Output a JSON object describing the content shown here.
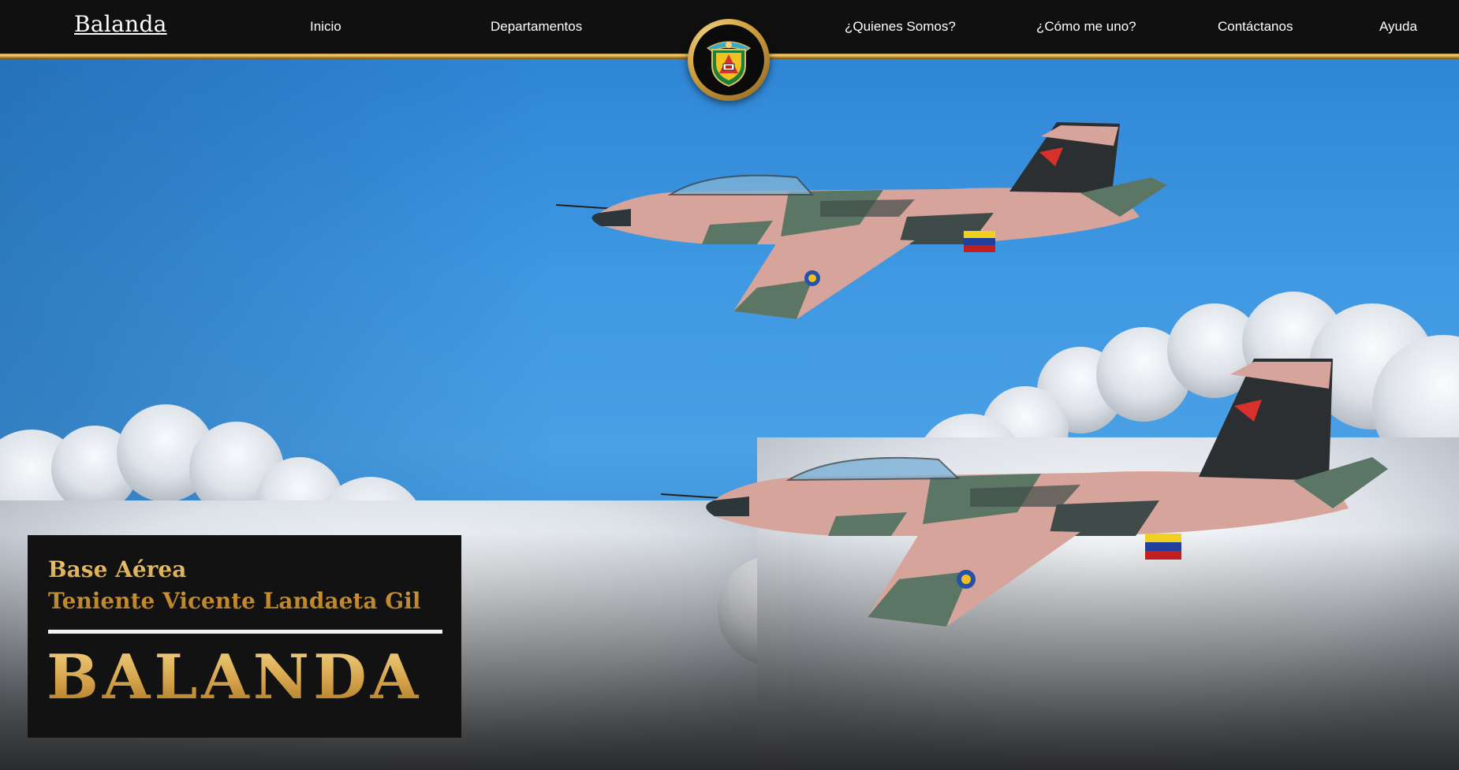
{
  "navbar": {
    "brand": "Balanda",
    "links": [
      "Inicio",
      "Departamentos",
      "¿Quienes Somos?",
      "¿Cómo me uno?",
      "Contáctanos",
      "Ayuda"
    ],
    "emblem_icon": "air-base-emblem-icon"
  },
  "hero": {
    "subtitle_line1": "Base Aérea",
    "subtitle_line2": "Teniente Vicente Landaeta Gil",
    "title": "BALANDA"
  },
  "colors": {
    "nav_background": "#101010",
    "gold_accent": "#d4a24a",
    "sky_blue": "#3f98e2",
    "card_background": "#121212"
  }
}
